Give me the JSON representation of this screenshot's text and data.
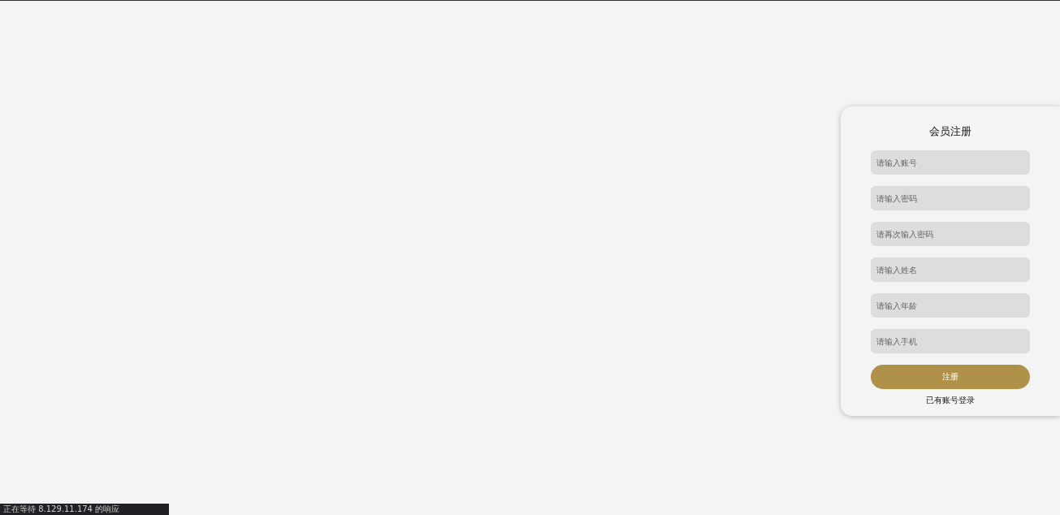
{
  "form": {
    "title": "会员注册",
    "fields": [
      {
        "placeholder": "请输入账号"
      },
      {
        "placeholder": "请输入密码"
      },
      {
        "placeholder": "请再次输入密码"
      },
      {
        "placeholder": "请输入姓名"
      },
      {
        "placeholder": "请输入年龄"
      },
      {
        "placeholder": "请输入手机"
      }
    ],
    "submit": "注册",
    "login_link": "已有账号登录"
  },
  "status_bar": {
    "text": "正在等待 8.129.11.174 的响应"
  }
}
